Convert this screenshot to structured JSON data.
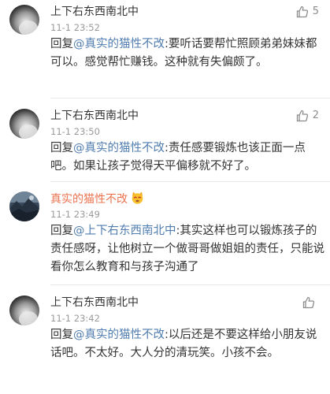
{
  "comments": [
    {
      "username": "上下右东西南北中",
      "time": "11-1 23:52",
      "likes": "5",
      "reply_prefix": "回复",
      "mention": "@真实的猫性不改",
      "text": ":要听话要帮忙照顾弟弟妹妹都可以。感觉帮忙赚钱。这种就有失偏颇了。"
    },
    {
      "username": "上下右东西南北中",
      "time": "11-1 23:50",
      "likes": "2",
      "reply_prefix": "回复",
      "mention": "@真实的猫性不改",
      "text": ":责任感要锻炼也该正面一点吧。如果让孩子觉得天平偏移就不好了。"
    },
    {
      "username": "真实的猫性不改",
      "time": "11-1 23:49",
      "likes": "",
      "reply_prefix": "回复",
      "mention": "@上下右东西南北中",
      "text": ":其实这样也可以锻炼孩子的责任感呀，让他树立一个做哥哥做姐姐的责任，只能说看你怎么教育和与孩子沟通了"
    },
    {
      "username": "上下右东西南北中",
      "time": "11-1 23:42",
      "likes": "",
      "reply_prefix": "回复",
      "mention": "@真实的猫性不改",
      "text": ":以后还是不要这样给小朋友说话吧。不太好。大人分的清玩笑。小孩不会。"
    }
  ],
  "colors": {
    "username_default": "#333333",
    "username_vip": "#eb7350",
    "mention": "#507daf",
    "time": "#9a9a9a",
    "like": "#8c8c8c"
  },
  "icons": {
    "like": "thumbs-up-icon",
    "avatar_default": "circular-silhouette-avatar",
    "avatar_vip": "landscape-photo-avatar",
    "vip_badge": "cat-face-emoji-icon"
  }
}
